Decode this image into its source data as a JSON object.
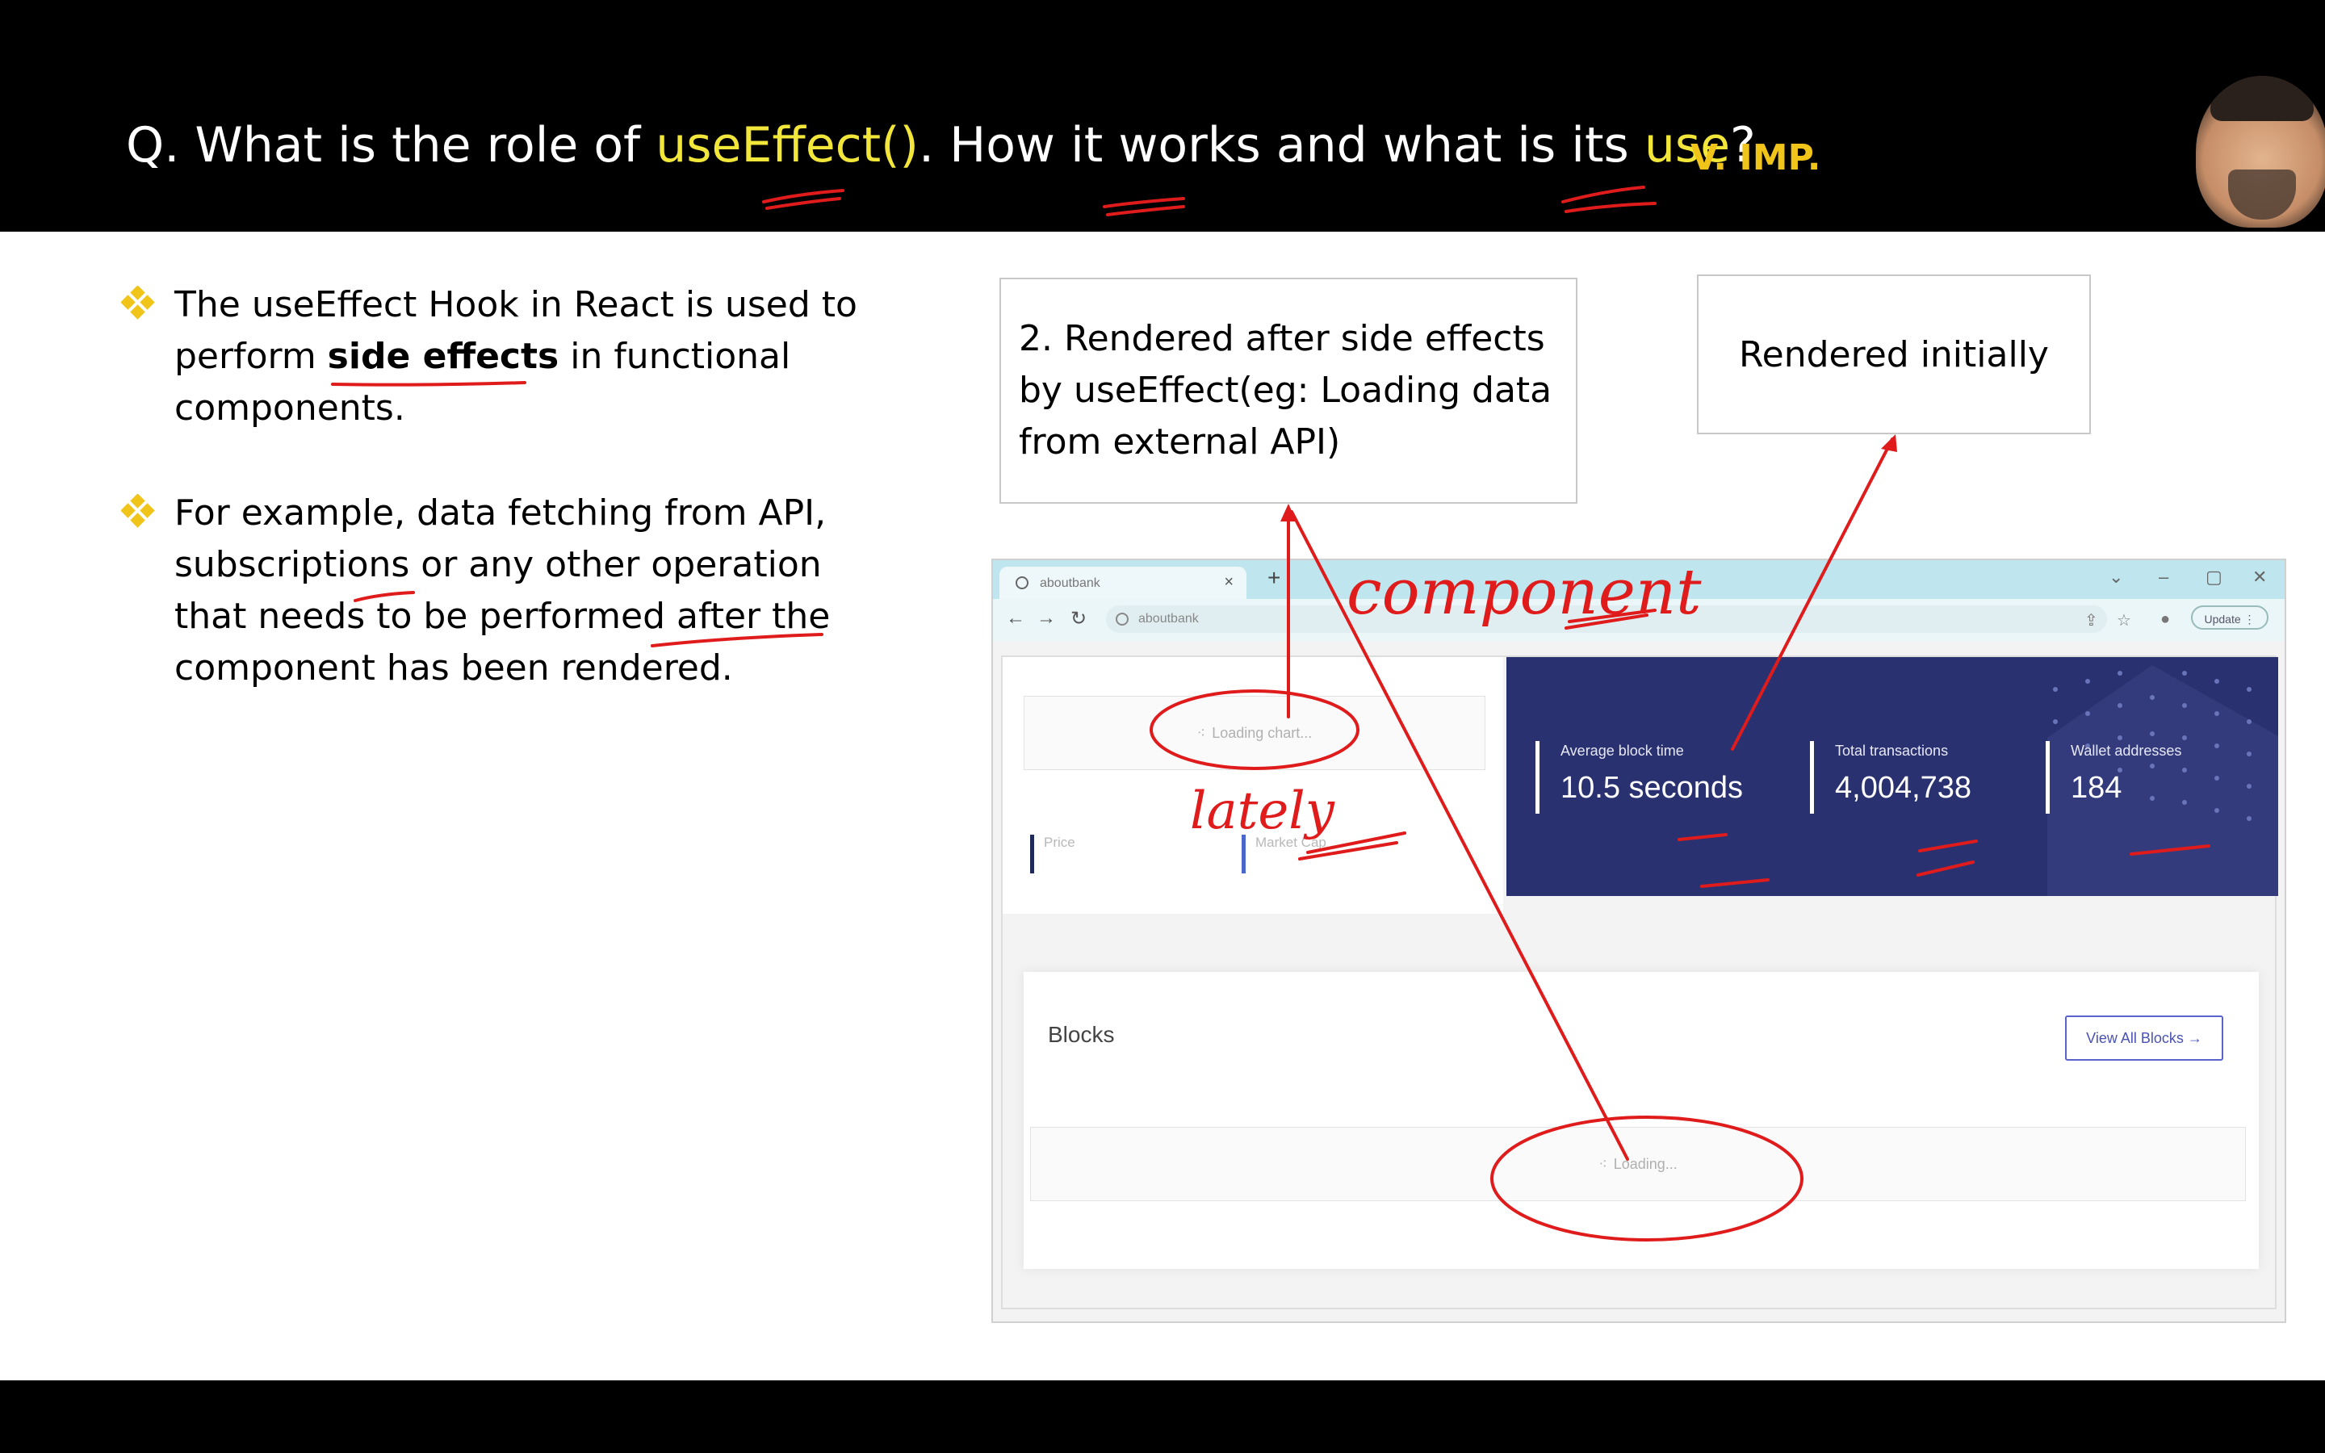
{
  "slide": {
    "question_prefix": "Q. What is the role of ",
    "question_hook": "useEffect()",
    "question_mid1": ". How it ",
    "question_works": "works",
    "question_mid2": " and what is its ",
    "question_use": "use",
    "question_end": "?",
    "importance": "V. IMP."
  },
  "bullets": {
    "b1_pre": "The useEffect Hook in React is used to perform ",
    "b1_bold": "side effects",
    "b1_post": " in functional components.",
    "b2": "For example, data fetching from API, subscriptions or any other operation that needs to be performed after the component has been rendered."
  },
  "callouts": {
    "after": "2. Rendered after side effects by useEffect(eg: Loading data from external API)",
    "initial": "Rendered initially"
  },
  "browser": {
    "tab_title": "aboutbank",
    "url": "aboutbank",
    "update_label": "Update"
  },
  "dashboard": {
    "loading_chart": "Loading chart...",
    "price_label": "Price",
    "market_cap_label": "Market Cap",
    "stats": [
      {
        "label": "Average block time",
        "value": "10.5 seconds"
      },
      {
        "label": "Total transactions",
        "value": "4,004,738"
      },
      {
        "label": "Wallet addresses",
        "value": "184"
      }
    ],
    "blocks_title": "Blocks",
    "view_all_label": "View All Blocks →",
    "loading_label": "Loading..."
  },
  "annotations": {
    "component": "component",
    "lately": "lately"
  },
  "colors": {
    "highlight": "#f2e63a",
    "importance": "#f0c419",
    "ink": "#e01b1b",
    "stat_card": "#2a3170"
  }
}
